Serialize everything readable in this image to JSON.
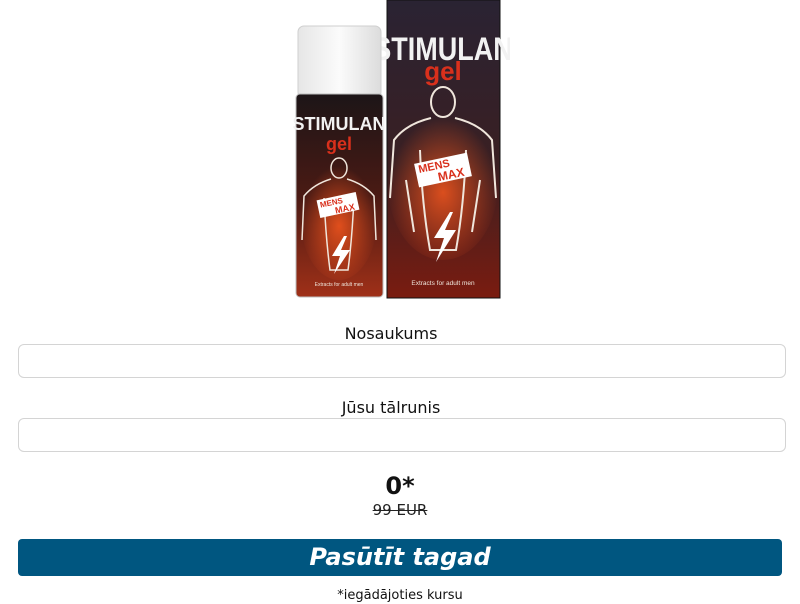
{
  "product": {
    "brand_line1": "STIMULAN",
    "brand_line2": "gel",
    "badge_line1": "MENS",
    "badge_line2": "MAX",
    "tagline": "Extracts for adult men"
  },
  "form": {
    "name_label": "Nosaukums",
    "name_value": "",
    "phone_label": "Jūsu tālrunis",
    "phone_value": ""
  },
  "price": {
    "new": "0*",
    "old": "99 EUR"
  },
  "order_button_label": "Pasūtīt tagad",
  "disclaimer": "*iegādājoties kursu",
  "colors": {
    "button": "#005680",
    "brand_red": "#d9301c",
    "box_dark": "#241c2a",
    "bottle_dark": "#1a1416"
  }
}
